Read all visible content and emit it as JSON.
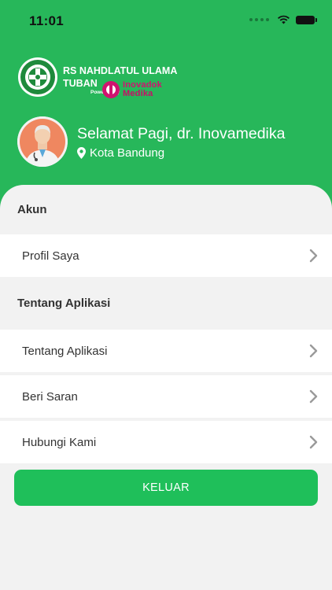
{
  "status_bar": {
    "time": "11:01"
  },
  "header": {
    "hospital_name": "RS NAHDLATUL ULAMA TUBAN",
    "powered_by": "Powered By",
    "brand_line1": "Inovadok",
    "brand_line2": "Medika",
    "greeting": "Selamat Pagi, dr. Inovamedika",
    "location": "Kota Bandung",
    "colors": {
      "primary": "#27b75a",
      "brand": "#d0136f"
    }
  },
  "sections": {
    "account_title": "Akun",
    "about_title": "Tentang Aplikasi"
  },
  "menu": {
    "profile": "Profil Saya",
    "about_app": "Tentang Aplikasi",
    "feedback": "Beri Saran",
    "contact": "Hubungi Kami"
  },
  "logout_label": "KELUAR"
}
